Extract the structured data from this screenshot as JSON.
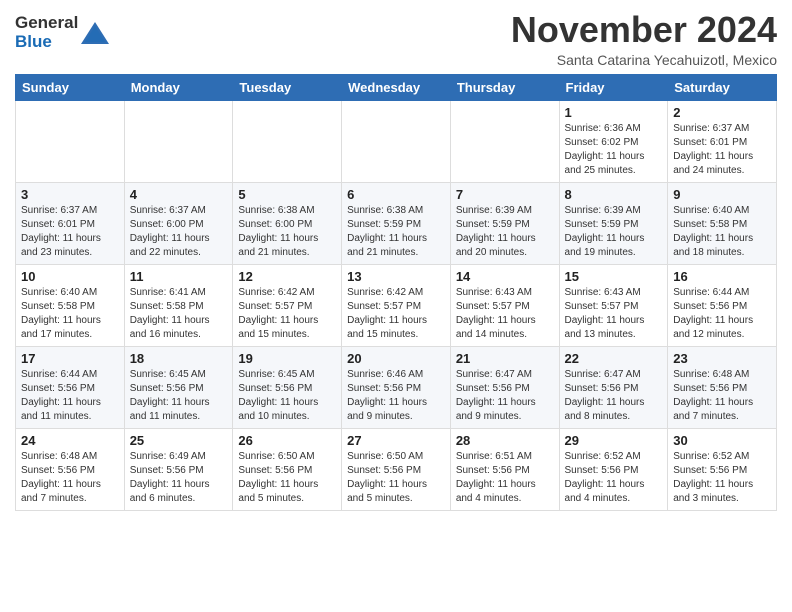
{
  "logo": {
    "line1": "General",
    "line2": "Blue"
  },
  "title": "November 2024",
  "subtitle": "Santa Catarina Yecahuizotl, Mexico",
  "days_of_week": [
    "Sunday",
    "Monday",
    "Tuesday",
    "Wednesday",
    "Thursday",
    "Friday",
    "Saturday"
  ],
  "weeks": [
    [
      {
        "day": "",
        "info": ""
      },
      {
        "day": "",
        "info": ""
      },
      {
        "day": "",
        "info": ""
      },
      {
        "day": "",
        "info": ""
      },
      {
        "day": "",
        "info": ""
      },
      {
        "day": "1",
        "info": "Sunrise: 6:36 AM\nSunset: 6:02 PM\nDaylight: 11 hours and 25 minutes."
      },
      {
        "day": "2",
        "info": "Sunrise: 6:37 AM\nSunset: 6:01 PM\nDaylight: 11 hours and 24 minutes."
      }
    ],
    [
      {
        "day": "3",
        "info": "Sunrise: 6:37 AM\nSunset: 6:01 PM\nDaylight: 11 hours and 23 minutes."
      },
      {
        "day": "4",
        "info": "Sunrise: 6:37 AM\nSunset: 6:00 PM\nDaylight: 11 hours and 22 minutes."
      },
      {
        "day": "5",
        "info": "Sunrise: 6:38 AM\nSunset: 6:00 PM\nDaylight: 11 hours and 21 minutes."
      },
      {
        "day": "6",
        "info": "Sunrise: 6:38 AM\nSunset: 5:59 PM\nDaylight: 11 hours and 21 minutes."
      },
      {
        "day": "7",
        "info": "Sunrise: 6:39 AM\nSunset: 5:59 PM\nDaylight: 11 hours and 20 minutes."
      },
      {
        "day": "8",
        "info": "Sunrise: 6:39 AM\nSunset: 5:59 PM\nDaylight: 11 hours and 19 minutes."
      },
      {
        "day": "9",
        "info": "Sunrise: 6:40 AM\nSunset: 5:58 PM\nDaylight: 11 hours and 18 minutes."
      }
    ],
    [
      {
        "day": "10",
        "info": "Sunrise: 6:40 AM\nSunset: 5:58 PM\nDaylight: 11 hours and 17 minutes."
      },
      {
        "day": "11",
        "info": "Sunrise: 6:41 AM\nSunset: 5:58 PM\nDaylight: 11 hours and 16 minutes."
      },
      {
        "day": "12",
        "info": "Sunrise: 6:42 AM\nSunset: 5:57 PM\nDaylight: 11 hours and 15 minutes."
      },
      {
        "day": "13",
        "info": "Sunrise: 6:42 AM\nSunset: 5:57 PM\nDaylight: 11 hours and 15 minutes."
      },
      {
        "day": "14",
        "info": "Sunrise: 6:43 AM\nSunset: 5:57 PM\nDaylight: 11 hours and 14 minutes."
      },
      {
        "day": "15",
        "info": "Sunrise: 6:43 AM\nSunset: 5:57 PM\nDaylight: 11 hours and 13 minutes."
      },
      {
        "day": "16",
        "info": "Sunrise: 6:44 AM\nSunset: 5:56 PM\nDaylight: 11 hours and 12 minutes."
      }
    ],
    [
      {
        "day": "17",
        "info": "Sunrise: 6:44 AM\nSunset: 5:56 PM\nDaylight: 11 hours and 11 minutes."
      },
      {
        "day": "18",
        "info": "Sunrise: 6:45 AM\nSunset: 5:56 PM\nDaylight: 11 hours and 11 minutes."
      },
      {
        "day": "19",
        "info": "Sunrise: 6:45 AM\nSunset: 5:56 PM\nDaylight: 11 hours and 10 minutes."
      },
      {
        "day": "20",
        "info": "Sunrise: 6:46 AM\nSunset: 5:56 PM\nDaylight: 11 hours and 9 minutes."
      },
      {
        "day": "21",
        "info": "Sunrise: 6:47 AM\nSunset: 5:56 PM\nDaylight: 11 hours and 9 minutes."
      },
      {
        "day": "22",
        "info": "Sunrise: 6:47 AM\nSunset: 5:56 PM\nDaylight: 11 hours and 8 minutes."
      },
      {
        "day": "23",
        "info": "Sunrise: 6:48 AM\nSunset: 5:56 PM\nDaylight: 11 hours and 7 minutes."
      }
    ],
    [
      {
        "day": "24",
        "info": "Sunrise: 6:48 AM\nSunset: 5:56 PM\nDaylight: 11 hours and 7 minutes."
      },
      {
        "day": "25",
        "info": "Sunrise: 6:49 AM\nSunset: 5:56 PM\nDaylight: 11 hours and 6 minutes."
      },
      {
        "day": "26",
        "info": "Sunrise: 6:50 AM\nSunset: 5:56 PM\nDaylight: 11 hours and 5 minutes."
      },
      {
        "day": "27",
        "info": "Sunrise: 6:50 AM\nSunset: 5:56 PM\nDaylight: 11 hours and 5 minutes."
      },
      {
        "day": "28",
        "info": "Sunrise: 6:51 AM\nSunset: 5:56 PM\nDaylight: 11 hours and 4 minutes."
      },
      {
        "day": "29",
        "info": "Sunrise: 6:52 AM\nSunset: 5:56 PM\nDaylight: 11 hours and 4 minutes."
      },
      {
        "day": "30",
        "info": "Sunrise: 6:52 AM\nSunset: 5:56 PM\nDaylight: 11 hours and 3 minutes."
      }
    ]
  ]
}
